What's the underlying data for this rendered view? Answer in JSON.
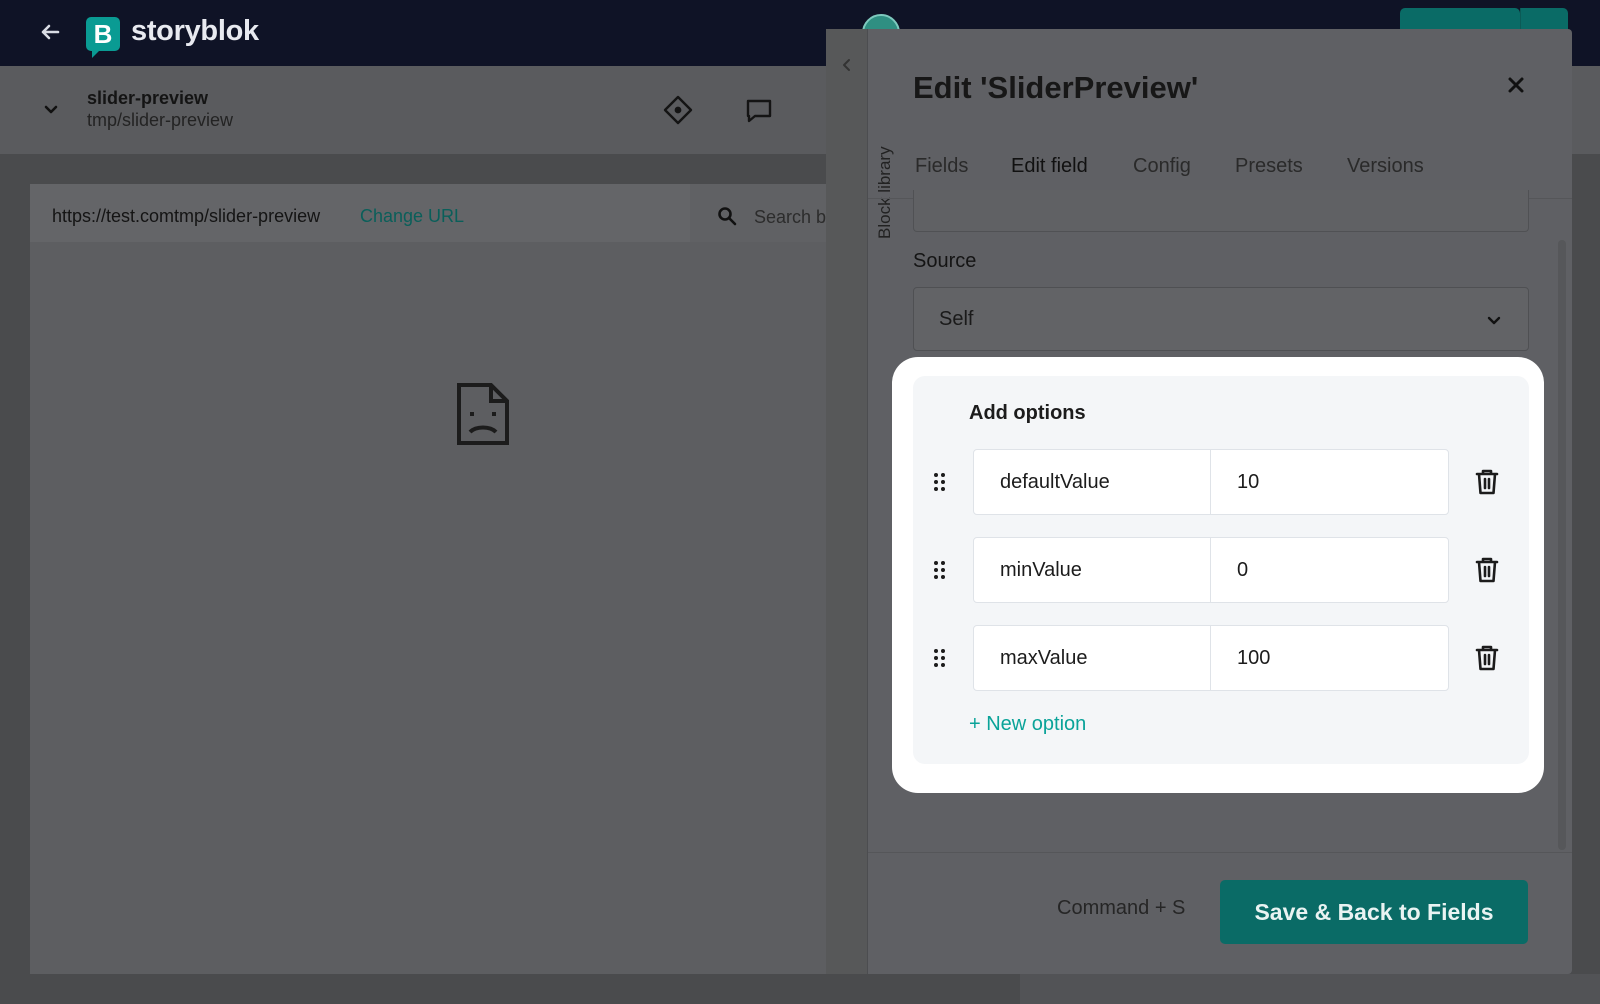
{
  "app": {
    "logo_letter": "B",
    "logo_text": "storyblok",
    "brand_color": "#0a9b93"
  },
  "story": {
    "name": "slider-preview",
    "slug": "tmp/slider-preview"
  },
  "preview": {
    "url": "https://test.comtmp/slider-preview",
    "change_url_label": "Change URL",
    "search_placeholder": "Search b"
  },
  "modal": {
    "sidebar_label": "Block library",
    "title": "Edit 'SliderPreview'",
    "tabs": [
      {
        "label": "Fields",
        "active": false
      },
      {
        "label": "Edit field",
        "active": true
      },
      {
        "label": "Config",
        "active": false
      },
      {
        "label": "Presets",
        "active": false
      },
      {
        "label": "Versions",
        "active": false
      }
    ],
    "source": {
      "label": "Source",
      "value": "Self"
    },
    "options": {
      "title": "Add options",
      "rows": [
        {
          "key": "defaultValue",
          "value": "10"
        },
        {
          "key": "minValue",
          "value": "0"
        },
        {
          "key": "maxValue",
          "value": "100"
        }
      ],
      "new_option_label": "+ New option"
    },
    "footer": {
      "shortcut_hint": "Command + S",
      "save_label": "Save & Back to Fields"
    }
  }
}
